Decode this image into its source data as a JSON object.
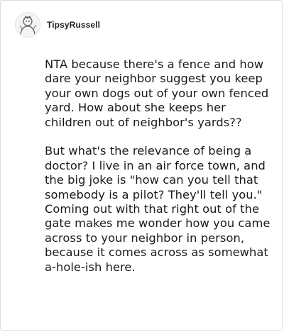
{
  "post": {
    "username": "TipsyRussell",
    "avatar_icon": "user-avatar-icon",
    "paragraphs": [
      "NTA because there's a fence and how dare your neighbor suggest you keep your own dogs out of your own fenced yard. How about she keeps her children out of neighbor's yards??",
      "But what's the relevance of being a doctor? I live in an air force town, and the big joke is \"how can you tell that somebody is a pilot? They'll tell you.\" Coming out with that right out of the gate makes me wonder how you came across to your neighbor in person, because it comes across as somewhat a-hole-ish here."
    ]
  },
  "colors": {
    "text": "#1a1a1a",
    "border": "#dcdcdc",
    "background": "#ffffff"
  }
}
